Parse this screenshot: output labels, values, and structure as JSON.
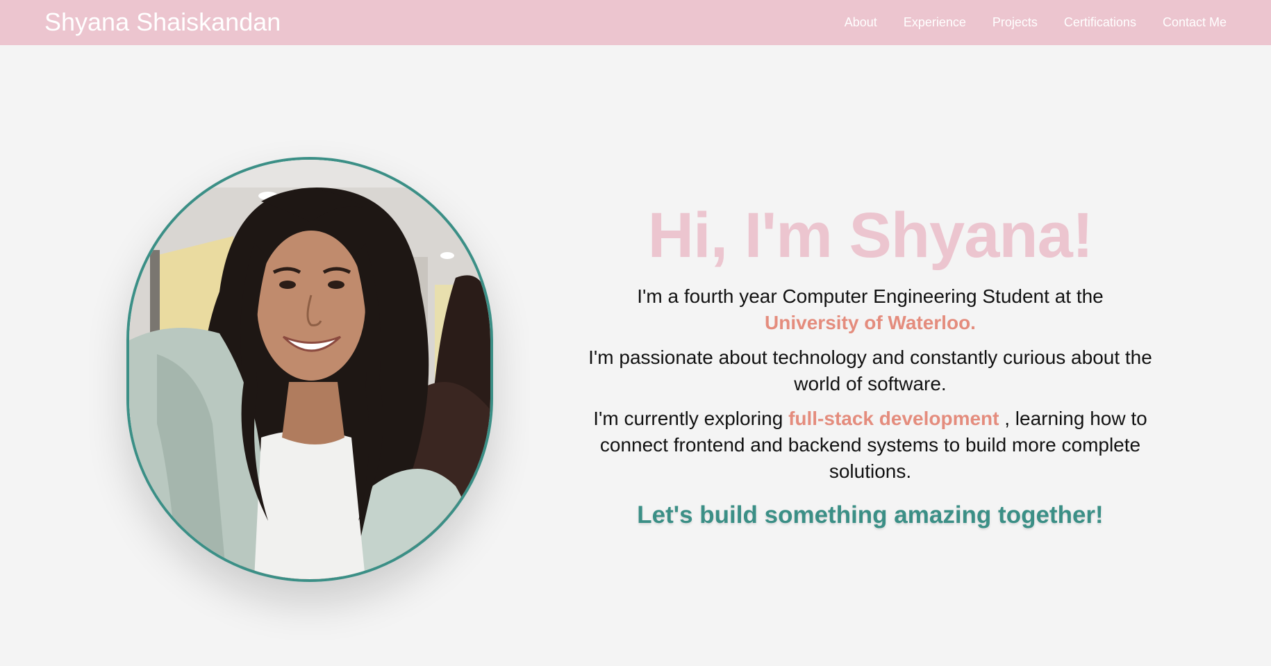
{
  "nav": {
    "brand": "Shyana Shaiskandan",
    "links": [
      "About",
      "Experience",
      "Projects",
      "Certifications",
      "Contact Me"
    ]
  },
  "hero": {
    "greeting": "Hi, I'm Shyana!",
    "line1_before": "I'm a fourth year Computer Engineering Student at the",
    "line1_highlight": "University of Waterloo.",
    "line2": "I'm passionate about technology and constantly curious about the world of software.",
    "line3_before": "I'm currently exploring",
    "line3_highlight": "full-stack development",
    "line3_after": ", learning how to connect frontend and backend systems to build more complete solutions.",
    "cta": "Let's build something amazing together!"
  },
  "colors": {
    "nav_background": "#ecc5cf",
    "greeting": "#ecc5cf",
    "highlight": "#e48c7d",
    "accent": "#3b8f86",
    "page_background": "#f4f4f4"
  },
  "profile_photo": {
    "icon": "profile-photo"
  }
}
